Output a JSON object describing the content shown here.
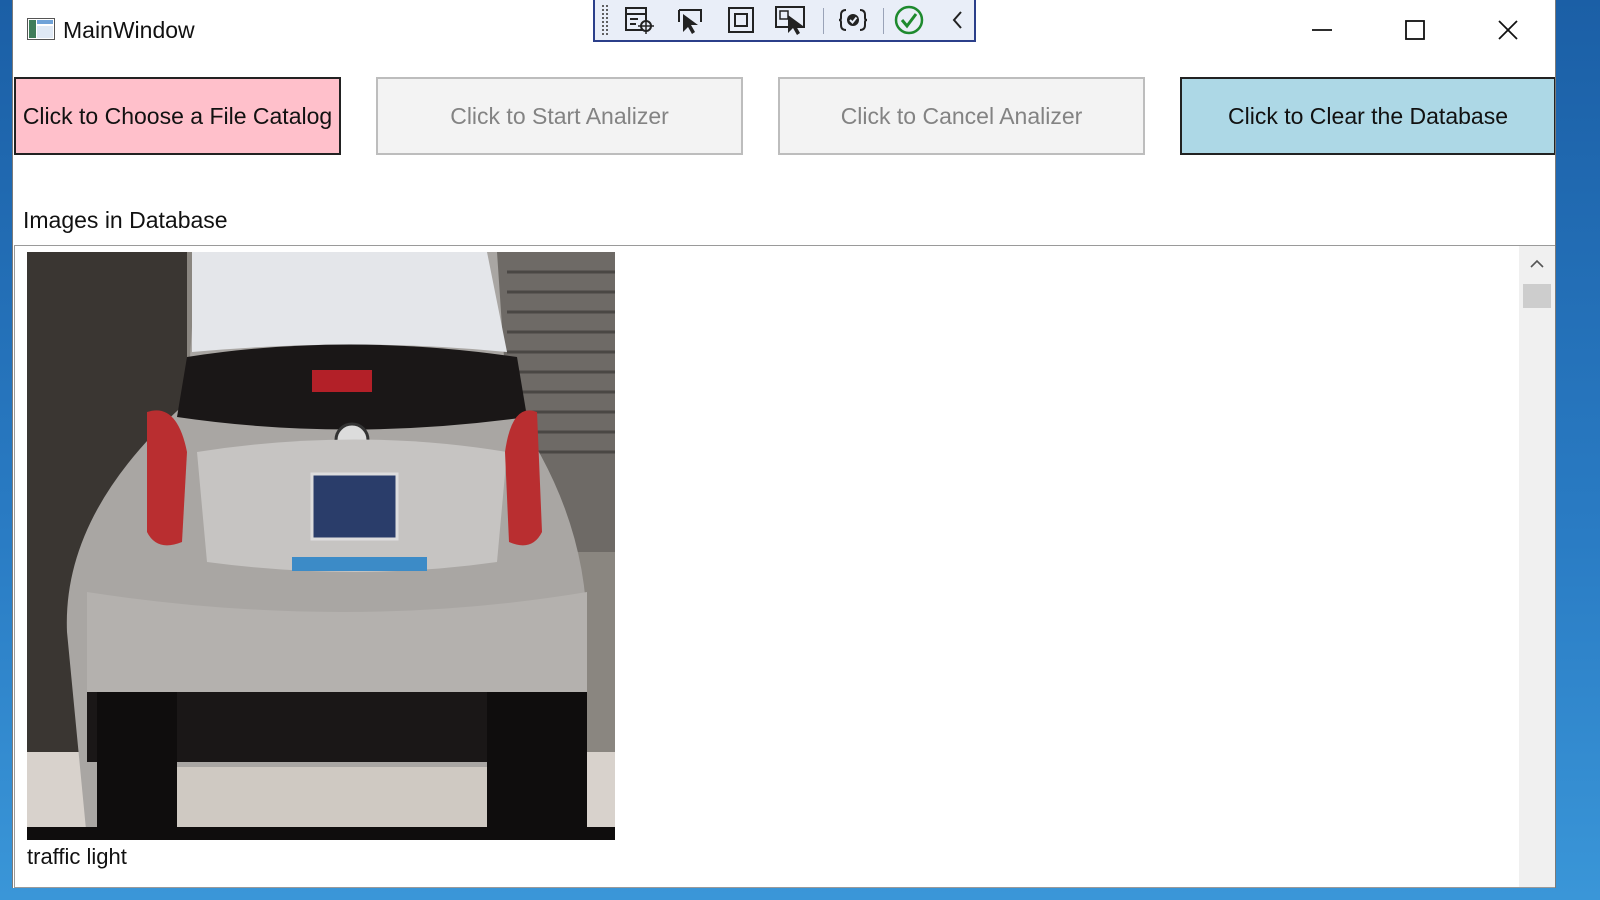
{
  "window": {
    "title": "MainWindow"
  },
  "buttons": {
    "choose_catalog": "Click to Choose a File Catalog",
    "start_analyzer": "Click to Start Analizer",
    "cancel_analyzer": "Click to Cancel Analizer",
    "clear_database": "Click to Clear the Database"
  },
  "database": {
    "label": "Images in Database",
    "items": [
      {
        "caption": "traffic light",
        "image": "car-rear-photo"
      }
    ]
  },
  "colors": {
    "choose_button_bg": "#ffc0cb",
    "clear_button_bg": "#add8e6",
    "disabled_button_bg": "#f3f3f3",
    "debug_toolbar_bg": "#e9eef8"
  },
  "icons": {
    "caption": [
      "minimize-icon",
      "maximize-icon",
      "close-icon"
    ],
    "debug_toolbar": [
      "live-visual-tree-icon",
      "select-element-icon",
      "display-layout-adorners-icon",
      "track-focused-element-icon",
      "binding-failures-icon",
      "hot-reload-check-icon",
      "collapse-toolbar-icon"
    ]
  }
}
